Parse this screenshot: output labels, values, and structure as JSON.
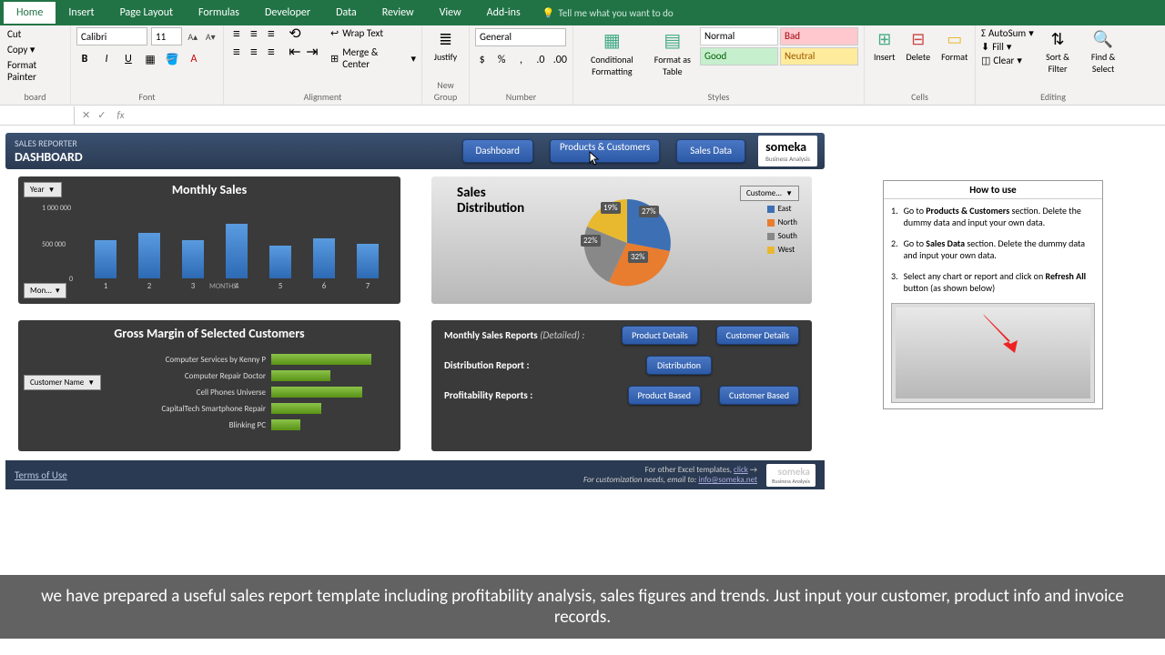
{
  "ribbon": {
    "tabs": [
      "Home",
      "Insert",
      "Page Layout",
      "Formulas",
      "Developer",
      "Data",
      "Review",
      "View",
      "Add-ins"
    ],
    "active_tab": "Home",
    "tell_me": "Tell me what you want to do",
    "clipboard": {
      "cut": "Cut",
      "copy": "Copy",
      "painter": "Format Painter",
      "label": "board"
    },
    "font": {
      "name": "Calibri",
      "size": "11",
      "label": "Font"
    },
    "alignment": {
      "wrap": "Wrap Text",
      "merge": "Merge & Center",
      "label": "Alignment"
    },
    "new_group": {
      "justify": "Justify",
      "label": "New Group"
    },
    "number": {
      "format": "General",
      "label": "Number"
    },
    "styles": {
      "cond": "Conditional Formatting",
      "table": "Format as Table",
      "normal": "Normal",
      "bad": "Bad",
      "good": "Good",
      "neutral": "Neutral",
      "label": "Styles"
    },
    "cells": {
      "insert": "Insert",
      "delete": "Delete",
      "format": "Format",
      "label": "Cells"
    },
    "editing": {
      "autosum": "AutoSum",
      "fill": "Fill",
      "clear": "Clear",
      "sort": "Sort & Filter",
      "find": "Find & Select",
      "label": "Editing"
    }
  },
  "dashboard": {
    "subtitle": "SALES REPORTER",
    "title": "DASHBOARD",
    "nav": {
      "dashboard": "Dashboard",
      "products": "Products & Customers",
      "sales": "Sales Data"
    },
    "logo": {
      "name": "someka",
      "tag": "Business Analysis"
    }
  },
  "monthly": {
    "title": "Monthly Sales",
    "year_filter": "Year",
    "month_filter": "Mon...",
    "axis_label": "MONTHS",
    "y_ticks": [
      "0",
      "500 000",
      "1 000 000"
    ]
  },
  "chart_data": [
    {
      "type": "bar",
      "title": "Monthly Sales",
      "categories": [
        "1",
        "2",
        "3",
        "4",
        "5",
        "6",
        "7"
      ],
      "values": [
        540000,
        640000,
        540000,
        760000,
        460000,
        560000,
        490000
      ],
      "ylim": [
        0,
        1000000
      ],
      "ylabel": "",
      "xlabel": "MONTHS"
    },
    {
      "type": "pie",
      "title": "Sales Distribution",
      "series": [
        {
          "name": "East",
          "value": 27,
          "color": "#3d6fb5"
        },
        {
          "name": "North",
          "value": 32,
          "color": "#e87c2f"
        },
        {
          "name": "South",
          "value": 22,
          "color": "#888888"
        },
        {
          "name": "West",
          "value": 19,
          "color": "#e8b92f"
        }
      ]
    },
    {
      "type": "bar",
      "title": "Gross Margin of Selected Customers",
      "orientation": "horizontal",
      "categories": [
        "Computer Services by Kenny P",
        "Computer Repair Doctor",
        "Cell Phones Universe",
        "CapitalTech Smartphone Repair",
        "Blinking PC"
      ],
      "values": [
        110,
        65,
        100,
        55,
        32
      ]
    }
  ],
  "distribution": {
    "title_l1": "Sales",
    "title_l2": "Distribution",
    "filter": "Custome...",
    "legend": [
      "East",
      "North",
      "South",
      "West"
    ],
    "labels": [
      "27%",
      "32%",
      "22%",
      "19%"
    ]
  },
  "gross": {
    "title": "Gross Margin of Selected Customers",
    "filter": "Customer Name"
  },
  "reports": {
    "monthly_label": "Monthly Sales Reports",
    "monthly_detail": "(Detailed) :",
    "dist_label": "Distribution Report :",
    "prof_label": "Profitability Reports :",
    "btns": {
      "prod_details": "Product Details",
      "cust_details": "Customer Details",
      "distribution": "Distribution",
      "prod_based": "Product Based",
      "cust_based": "Customer Based"
    }
  },
  "footer": {
    "terms": "Terms of Use",
    "line1_a": "For other Excel templates,",
    "line1_b": "click",
    "line2_a": "For customization needs, email to:",
    "line2_b": "info@someka.net"
  },
  "howto": {
    "title": "How to use",
    "items": [
      {
        "num": "1.",
        "pre": "Go to ",
        "bold": "Products & Customers",
        "post": " section. Delete the dummy data and input your own data."
      },
      {
        "num": "2.",
        "pre": "Go to ",
        "bold": "Sales Data",
        "post": " section. Delete the dummy data and input your own data."
      },
      {
        "num": "3.",
        "pre": "Select any chart or report and click on ",
        "bold": "Refresh All",
        "post": " button (as shown below)"
      }
    ]
  },
  "subtitle": "we have prepared a useful sales report template including profitability analysis, sales figures and trends. Just input your customer, product info and invoice records."
}
